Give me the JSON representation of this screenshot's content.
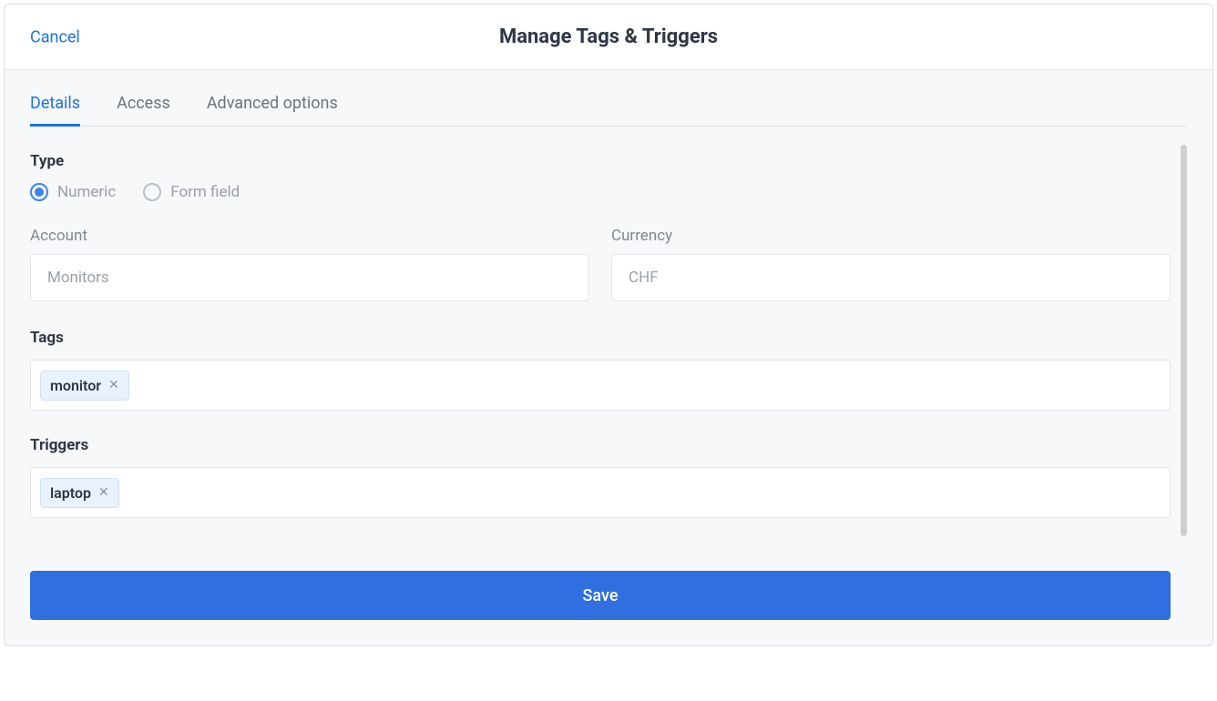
{
  "header": {
    "cancel_label": "Cancel",
    "title": "Manage Tags & Triggers"
  },
  "tabs": {
    "details": "Details",
    "access": "Access",
    "advanced": "Advanced options",
    "active": "details"
  },
  "type_section": {
    "label": "Type",
    "options": {
      "numeric": "Numeric",
      "form_field": "Form field"
    },
    "selected": "numeric"
  },
  "account": {
    "label": "Account",
    "value": "Monitors"
  },
  "currency": {
    "label": "Currency",
    "value": "CHF"
  },
  "tags_section": {
    "label": "Tags",
    "chips": [
      "monitor"
    ]
  },
  "triggers_section": {
    "label": "Triggers",
    "chips": [
      "laptop"
    ]
  },
  "save_label": "Save"
}
